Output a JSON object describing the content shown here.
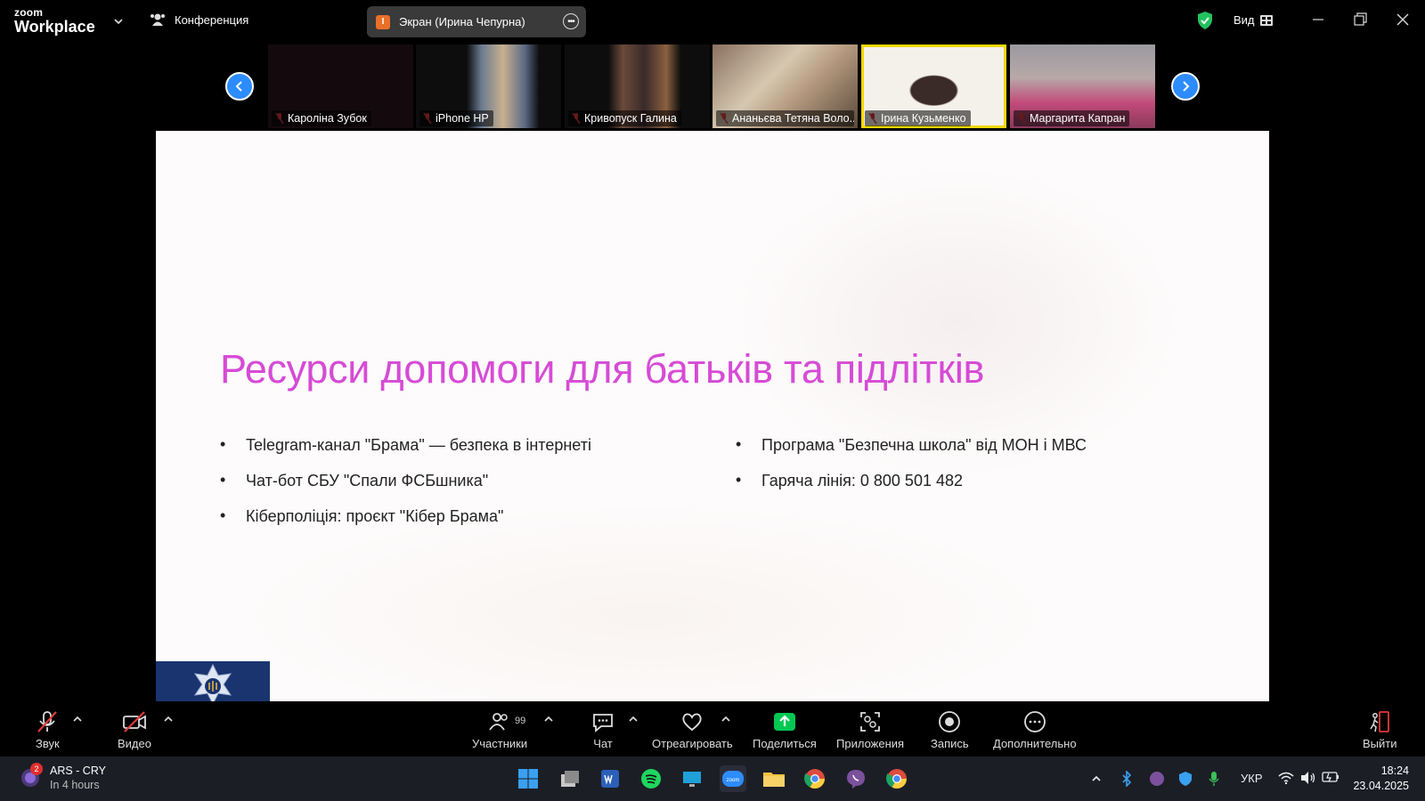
{
  "app": {
    "logo_small": "zoom",
    "logo_big": "Workplace",
    "meeting_label": "Конференция",
    "share_label": "Экран (Ирина Чепурна)",
    "share_badge": "I",
    "view_label": "Вид"
  },
  "participants": [
    {
      "name": "Кароліна Зубок",
      "active": false
    },
    {
      "name": "iPhone HP",
      "active": false
    },
    {
      "name": "Кривопуск Галина",
      "active": false
    },
    {
      "name": "Ананьєва Тетяна Воло...",
      "active": false
    },
    {
      "name": "Ірина Кузьменко",
      "active": true
    },
    {
      "name": "Маргарита Капран",
      "active": false
    }
  ],
  "slide": {
    "title": "Ресурси допомоги для батьків та підлітків",
    "left_items": [
      "Telegram-канал \"Брама\" — безпека в інтернеті",
      "Чат-бот СБУ \"Спали ФСБшника\"",
      "Кіберполіція: проєкт \"Кібер Брама\""
    ],
    "right_items": [
      "Програма \"Безпечна школа\" від МОН і МВС",
      "Гаряча лінія: 0 800 501 482"
    ]
  },
  "toolbar": {
    "audio": "Звук",
    "video": "Видео",
    "participants": "Участники",
    "participants_count": "99",
    "chat": "Чат",
    "react": "Отреагировать",
    "share": "Поделиться",
    "apps": "Приложения",
    "record": "Запись",
    "more": "Дополнительно",
    "leave": "Выйти"
  },
  "taskbar": {
    "notification_title": "ARS - CRY",
    "notification_sub": "In 4 hours",
    "notification_count": "2",
    "language": "УКР",
    "time": "18:24",
    "date": "23.04.2025"
  },
  "colors": {
    "accent": "#2d8cff",
    "slide_title": "#d64bd6",
    "active_speaker": "#f5d800",
    "share_green": "#00c853"
  }
}
